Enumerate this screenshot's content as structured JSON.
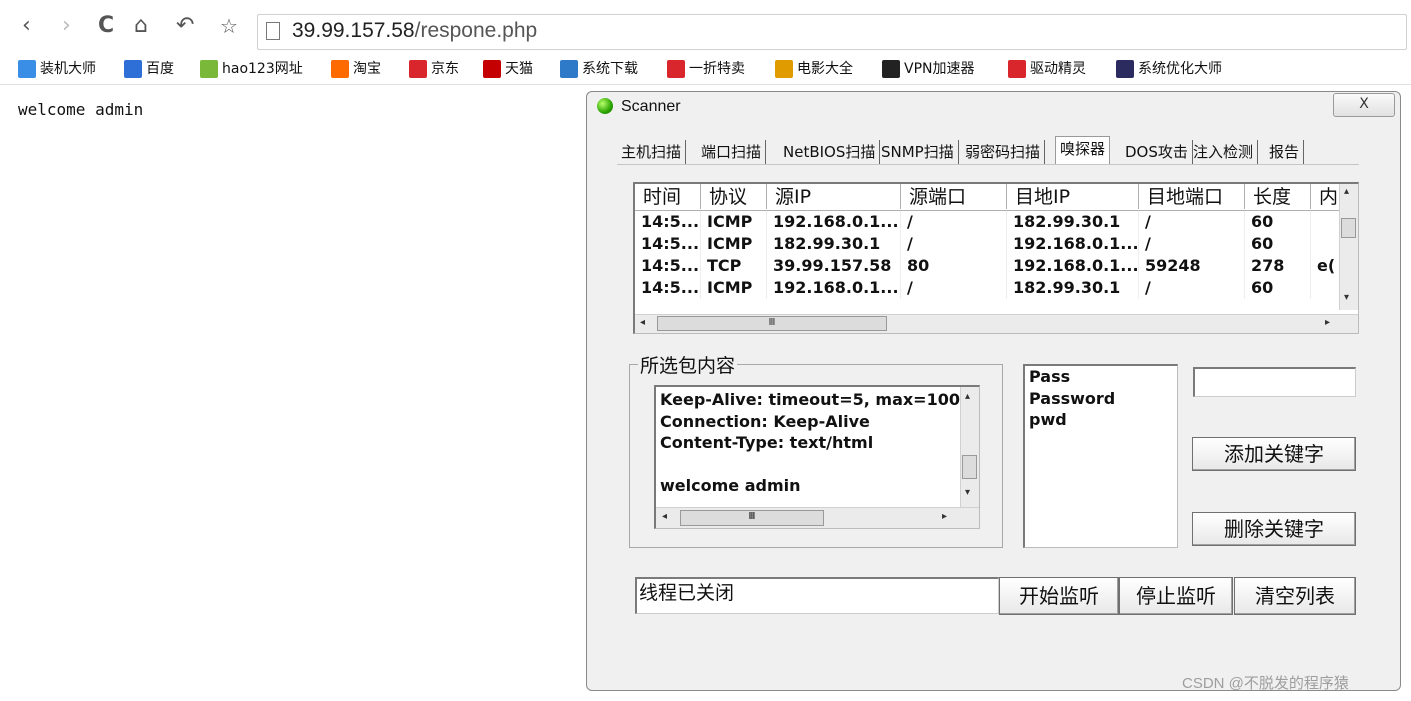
{
  "browser": {
    "url_host": "39.99.157.58",
    "url_path": "/respone.php",
    "bookmarks": [
      {
        "label": "装机大师",
        "color": "#3a8ee6"
      },
      {
        "label": "百度",
        "color": "#2d6fd6"
      },
      {
        "label": "hao123网址",
        "color": "#7ab83a"
      },
      {
        "label": "淘宝",
        "color": "#ff6a00"
      },
      {
        "label": "京东",
        "color": "#d9262c"
      },
      {
        "label": "天猫",
        "color": "#c40000"
      },
      {
        "label": "系统下载",
        "color": "#2f79c9"
      },
      {
        "label": "一折特卖",
        "color": "#d9262c"
      },
      {
        "label": "电影大全",
        "color": "#e09b00"
      },
      {
        "label": "VPN加速器",
        "color": "#222222"
      },
      {
        "label": "驱动精灵",
        "color": "#d9262c"
      },
      {
        "label": "系统优化大师",
        "color": "#2b2b60"
      }
    ]
  },
  "page": {
    "text": "welcome admin"
  },
  "scanner": {
    "title": "Scanner",
    "close_label": "X",
    "tabs": [
      "主机扫描",
      "端口扫描",
      "NetBIOS扫描",
      "SNMP扫描",
      "弱密码扫描",
      "嗅探器",
      "DOS攻击",
      "注入检测",
      "报告"
    ],
    "selected_tab": "嗅探器",
    "table": {
      "columns": [
        "时间",
        "协议",
        "源IP",
        "源端口",
        "目地IP",
        "目地端口",
        "长度",
        "内"
      ],
      "rows": [
        [
          "14:5...",
          "ICMP",
          "192.168.0.1...",
          "/",
          "182.99.30.1",
          "/",
          "60",
          ""
        ],
        [
          "14:5...",
          "ICMP",
          "182.99.30.1",
          "/",
          "192.168.0.1...",
          "/",
          "60",
          ""
        ],
        [
          "14:5...",
          "TCP",
          "39.99.157.58",
          "80",
          "192.168.0.1...",
          "59248",
          "278",
          "e("
        ],
        [
          "14:5...",
          "ICMP",
          "192.168.0.1...",
          "/",
          "182.99.30.1",
          "/",
          "60",
          ""
        ]
      ]
    },
    "packet_group_label": "所选包内容",
    "packet_lines": [
      "Keep-Alive: timeout=5, max=100",
      "Connection: Keep-Alive",
      "Content-Type: text/html",
      "",
      "welcome admin"
    ],
    "keywords": [
      "Pass",
      "Password",
      "pwd"
    ],
    "keyword_input_value": "",
    "buttons": {
      "add_keyword": "添加关键字",
      "delete_keyword": "删除关键字",
      "start_listen": "开始监听",
      "stop_listen": "停止监听",
      "clear_list": "清空列表"
    },
    "status_text": "线程已关闭"
  },
  "watermark": "CSDN @不脱发的程序猿"
}
